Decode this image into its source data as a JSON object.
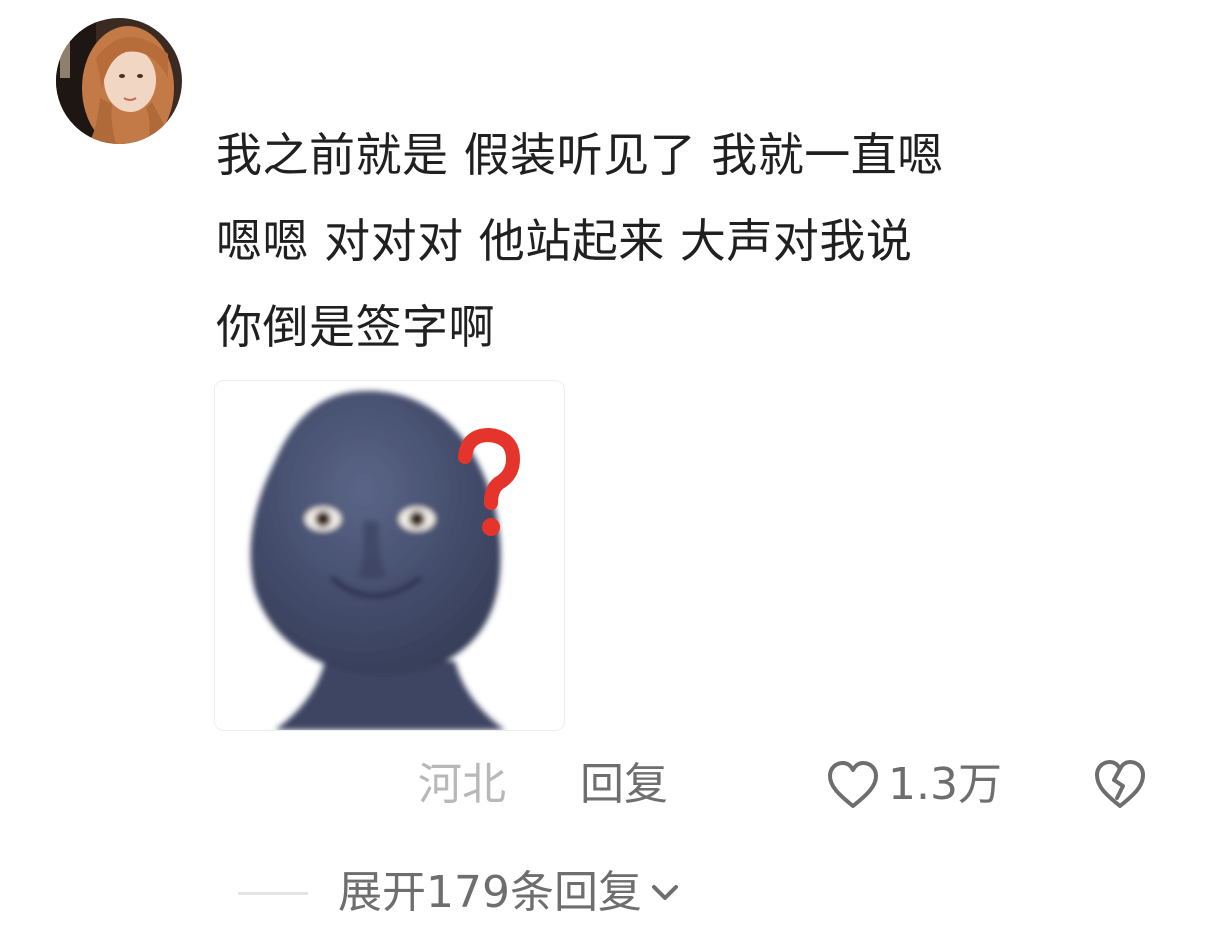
{
  "comment": {
    "avatar_icon": "user-avatar",
    "text_lines": [
      "我之前就是 假装听见了 我就一直嗯",
      "嗯嗯 对对对 他站起来 大声对我说",
      "你倒是签字啊"
    ],
    "sticker_icon": "alien-question-sticker",
    "location": "河北",
    "reply_label": "回复",
    "like_count": "1.3万",
    "like_icon": "heart-outline-icon",
    "dislike_icon": "broken-heart-icon",
    "expand_replies_label": "展开179条回复",
    "expand_icon": "chevron-down-icon"
  },
  "colors": {
    "text_primary": "#202020",
    "text_secondary": "#6e6e6e",
    "text_muted": "#b8b8b8",
    "divider": "#e4e4e4",
    "question_mark": "#e5342b"
  }
}
